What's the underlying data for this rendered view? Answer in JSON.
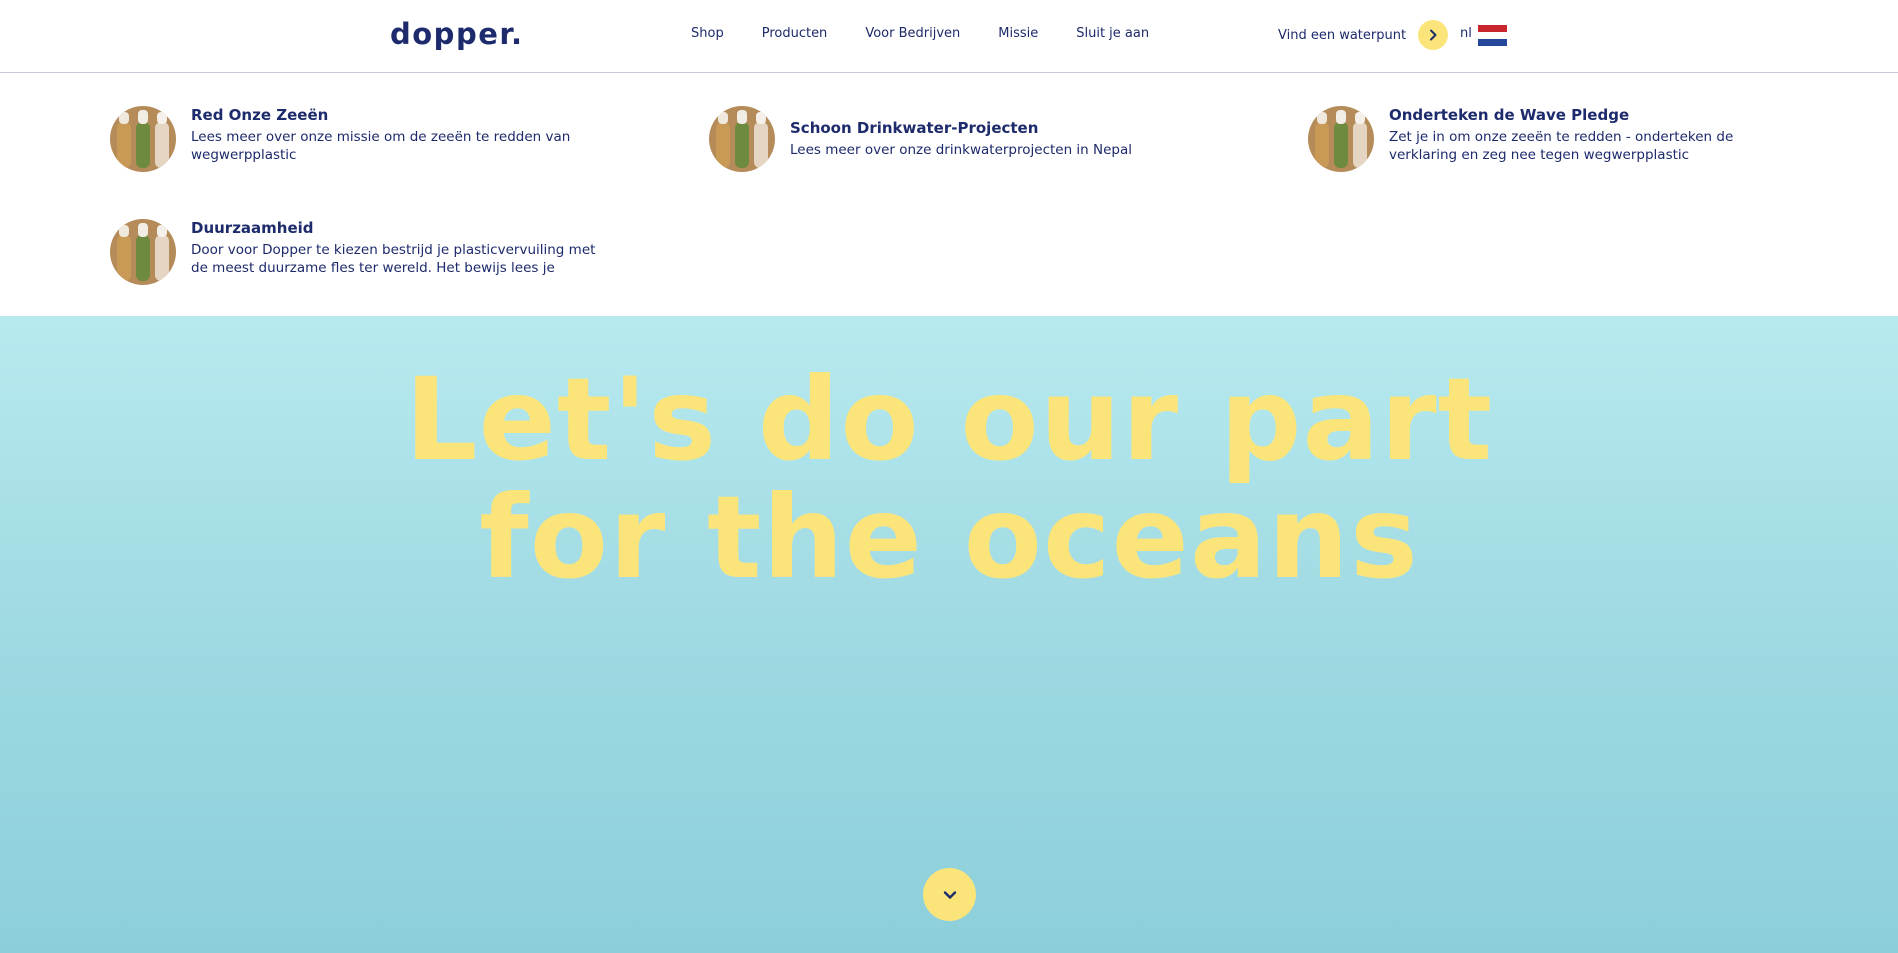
{
  "header": {
    "logo": "dopper.",
    "nav": [
      "Shop",
      "Producten",
      "Voor Bedrijven",
      "Missie",
      "Sluit je aan"
    ],
    "find_label": "Vind een waterpunt",
    "lang": "nl",
    "icons": {
      "arrow": "chevron-right-icon",
      "flag": "netherlands-flag-icon"
    },
    "colors": {
      "brand": "#1d2a6b",
      "accent": "#fbe57b"
    }
  },
  "dropdown": {
    "items": [
      {
        "title": "Red Onze Zeeën",
        "desc": "Lees meer over onze missie om de zeeën te redden van wegwerpplastic"
      },
      {
        "title": "Schoon Drinkwater-Projecten",
        "desc": "Lees meer over onze drinkwaterprojecten in Nepal"
      },
      {
        "title": "Onderteken de Wave Pledge",
        "desc": "Zet je in om onze zeeën te redden - onderteken de verklaring en zeg nee tegen wegwerpplastic"
      },
      {
        "title": "Duurzaamheid",
        "desc": "Door voor Dopper te kiezen bestrijd je plasticvervuiling met de meest duurzame fles ter wereld. Het bewijs lees je"
      }
    ]
  },
  "hero": {
    "line1": "Let's do our part",
    "line2": "for the oceans",
    "scroll_icon": "chevron-down-icon"
  }
}
